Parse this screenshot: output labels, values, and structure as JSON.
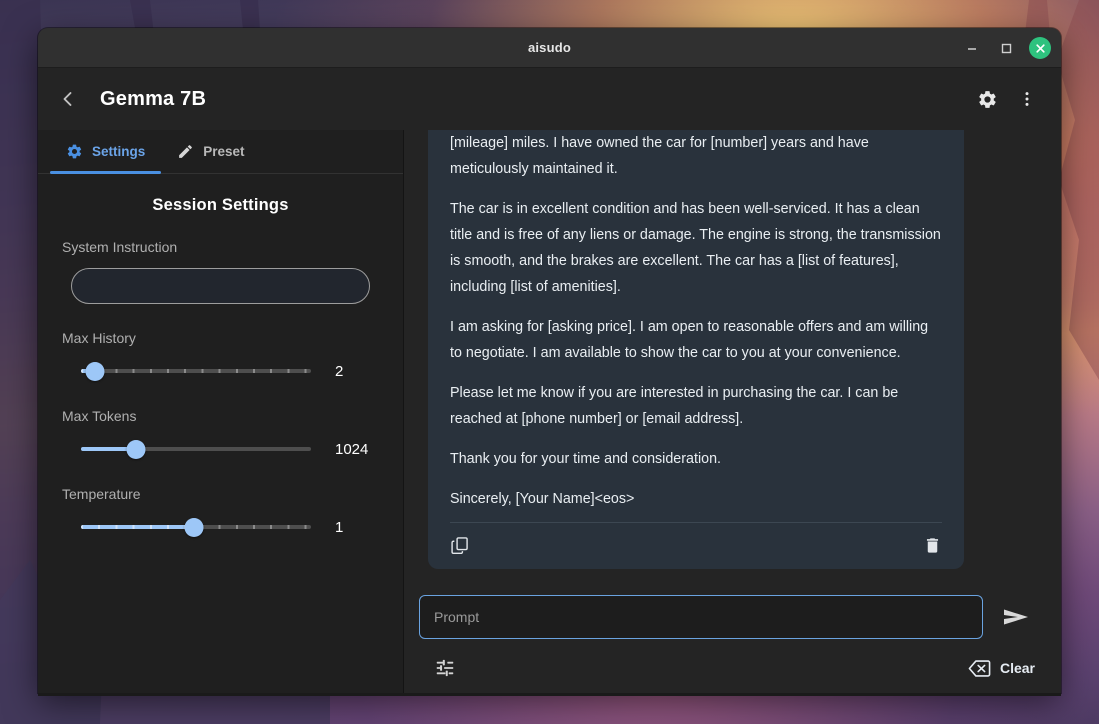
{
  "window": {
    "title": "aisudo",
    "controls": {
      "minimize": "minimize-window",
      "maximize": "maximize-window",
      "close": "close-window"
    }
  },
  "header": {
    "back_label": "Back",
    "page_title": "Gemma 7B",
    "settings_icon": "gear-icon",
    "menu_icon": "more-vertical-icon"
  },
  "sidebar": {
    "tabs": [
      {
        "label": "Settings",
        "icon": "gear-icon",
        "active": true
      },
      {
        "label": "Preset",
        "icon": "pencil-icon",
        "active": false
      }
    ],
    "section_title": "Session Settings",
    "system_instruction": {
      "label": "System Instruction",
      "value": "",
      "placeholder": ""
    },
    "sliders": [
      {
        "label": "Max History",
        "value": "2",
        "fill_percent": 6,
        "ticked": true
      },
      {
        "label": "Max Tokens",
        "value": "1024",
        "fill_percent": 24,
        "ticked": false
      },
      {
        "label": "Temperature",
        "value": "1",
        "fill_percent": 49,
        "ticked": true
      }
    ]
  },
  "chat": {
    "message": {
      "paragraphs": [
        "[mileage] miles. I have owned the car for [number] years and have meticulously maintained it.",
        "The car is in excellent condition and has been well-serviced. It has a clean title and is free of any liens or damage. The engine is strong, the transmission is smooth, and the brakes are excellent. The car has a [list of features], including [list of amenities].",
        "I am asking for [asking price]. I am open to reasonable offers and am willing to negotiate. I am available to show the car to you at your convenience.",
        "Please let me know if you are interested in purchasing the car. I can be reached at [phone number] or [email address].",
        "Thank you for your time and consideration.",
        "Sincerely, [Your Name]<eos>"
      ],
      "copy_icon": "copy-icon",
      "delete_icon": "trash-icon"
    }
  },
  "composer": {
    "prompt_placeholder": "Prompt",
    "prompt_value": "",
    "send_icon": "send-arrow-icon",
    "tune_icon": "tune-sliders-icon",
    "clear_label": "Clear",
    "clear_icon": "backspace-delete-icon"
  },
  "colors": {
    "accent_blue": "#4a90e2",
    "slider_blue": "#9dc7f7",
    "close_green": "#2ec27e",
    "bubble_bg": "#29323c",
    "window_bg": "#242424",
    "sidebar_bg": "#1f1f1f"
  }
}
